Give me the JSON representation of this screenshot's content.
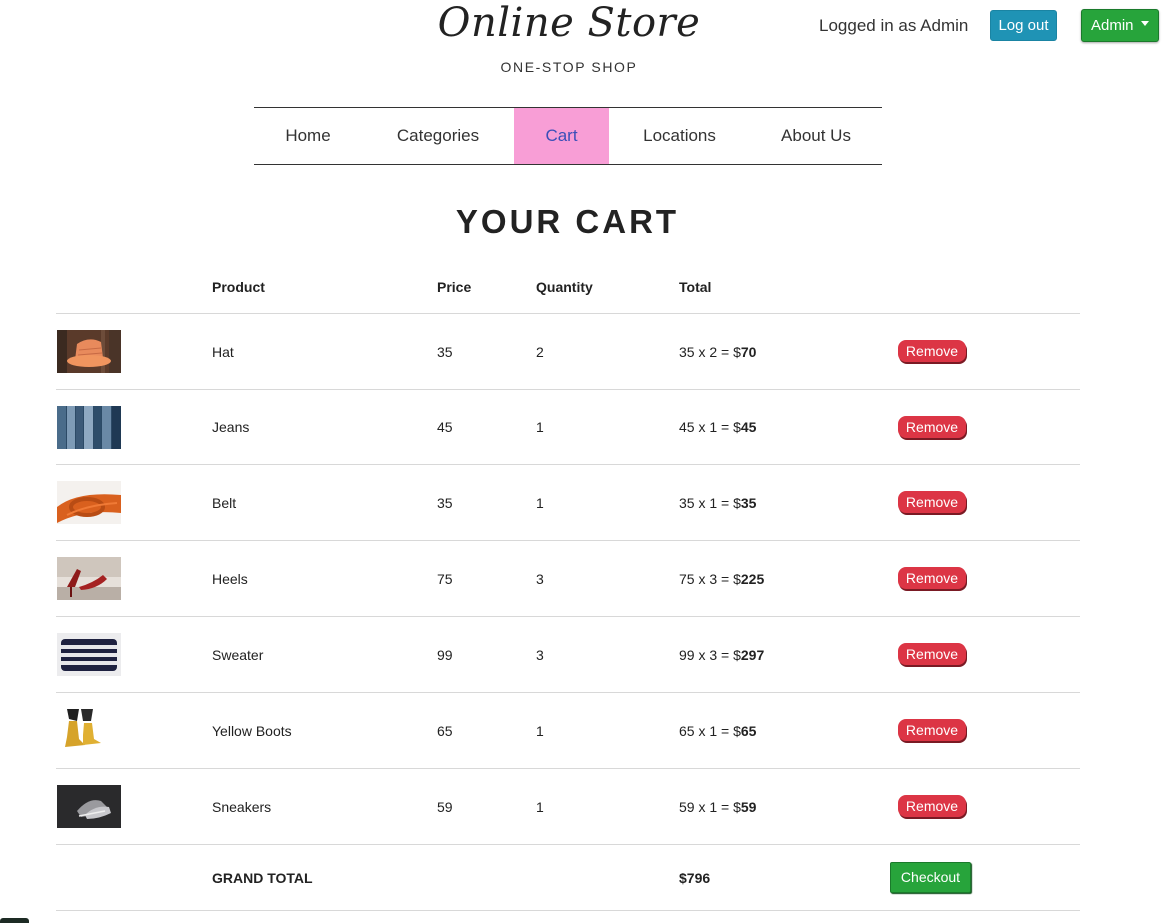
{
  "header": {
    "title": "Online Store",
    "subtitle": "ONE-STOP SHOP",
    "login_text": "Logged in as Admin",
    "logout_label": "Log out",
    "admin_label": "Admin"
  },
  "nav": {
    "items": [
      {
        "label": "Home"
      },
      {
        "label": "Categories"
      },
      {
        "label": "Cart",
        "active": true
      },
      {
        "label": "Locations"
      },
      {
        "label": "About Us"
      }
    ]
  },
  "page_title": "YOUR CART",
  "table": {
    "headers": {
      "product": "Product",
      "price": "Price",
      "quantity": "Quantity",
      "total": "Total"
    },
    "rows": [
      {
        "product": "Hat",
        "price": "35",
        "quantity": "2",
        "total_expr": "35 x 2 = $",
        "total_value": "70",
        "remove_label": "Remove",
        "thumb": "hat"
      },
      {
        "product": "Jeans",
        "price": "45",
        "quantity": "1",
        "total_expr": "45 x 1 = $",
        "total_value": "45",
        "remove_label": "Remove",
        "thumb": "jeans"
      },
      {
        "product": "Belt",
        "price": "35",
        "quantity": "1",
        "total_expr": "35 x 1 = $",
        "total_value": "35",
        "remove_label": "Remove",
        "thumb": "belt"
      },
      {
        "product": "Heels",
        "price": "75",
        "quantity": "3",
        "total_expr": "75 x 3 = $",
        "total_value": "225",
        "remove_label": "Remove",
        "thumb": "heels"
      },
      {
        "product": "Sweater",
        "price": "99",
        "quantity": "3",
        "total_expr": "99 x 3 = $",
        "total_value": "297",
        "remove_label": "Remove",
        "thumb": "sweater"
      },
      {
        "product": "Yellow Boots",
        "price": "65",
        "quantity": "1",
        "total_expr": "65 x 1 = $",
        "total_value": "65",
        "remove_label": "Remove",
        "thumb": "yellow-boots"
      },
      {
        "product": "Sneakers",
        "price": "59",
        "quantity": "1",
        "total_expr": "59 x 1 = $",
        "total_value": "59",
        "remove_label": "Remove",
        "thumb": "sneakers"
      }
    ],
    "grand_total_label": "GRAND TOTAL",
    "grand_total_value": "$796",
    "checkout_label": "Checkout"
  },
  "colors": {
    "nav_active_bg": "#f89ed6",
    "nav_active_text": "#3a4fb8",
    "logout_button": "#1f93b5",
    "admin_button": "#27a43b",
    "remove_button": "#dc3545",
    "checkout_button": "#27a43b"
  }
}
